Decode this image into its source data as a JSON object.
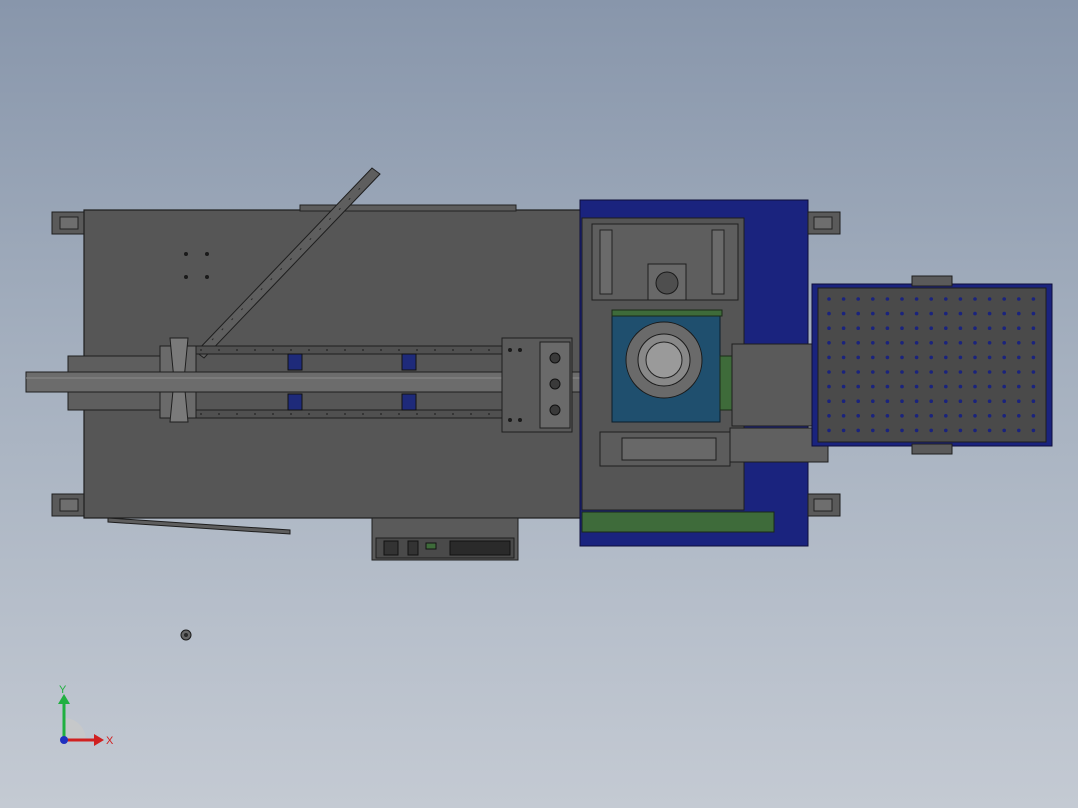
{
  "viewport": {
    "background_top": "#8896ab",
    "background_bottom": "#c4cad3"
  },
  "model": {
    "body_color": "#555555",
    "edge_color": "#1e1e1e",
    "accent_blue": "#1a237e",
    "motor_blue": "#1f4f6e",
    "green_part": "#3e6b3a"
  },
  "triad": {
    "y_label": "Y",
    "x_label": "X",
    "y_color": "#20b040",
    "x_color": "#d02020",
    "z_color": "#2030c0"
  }
}
